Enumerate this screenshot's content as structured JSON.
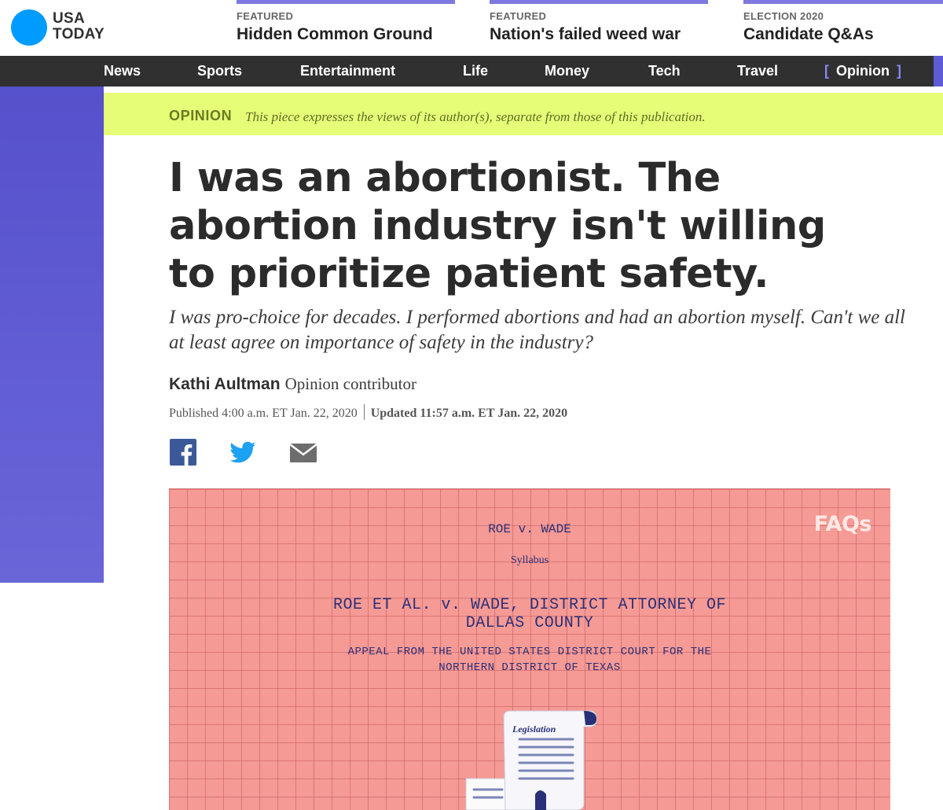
{
  "brand": {
    "line1": "USA",
    "line2": "TODAY"
  },
  "promos": [
    {
      "kicker": "FEATURED",
      "headline": "Hidden Common Ground"
    },
    {
      "kicker": "FEATURED",
      "headline": "Nation's failed weed war"
    },
    {
      "kicker": "ELECTION 2020",
      "headline": "Candidate Q&As"
    }
  ],
  "nav": {
    "items": [
      "News",
      "Sports",
      "Entertainment",
      "Life",
      "Money",
      "Tech",
      "Travel"
    ],
    "active": {
      "open": "[",
      "label": "Opinion",
      "close": "]"
    }
  },
  "banner": {
    "label": "OPINION",
    "note": "This piece expresses the views of its author(s), separate from those of this publication."
  },
  "article": {
    "title": "I was an abortionist. The abortion industry isn't willing to prioritize patient safety.",
    "dek": "I was pro-choice for decades. I performed abortions and had an abortion myself. Can't we all at least agree on importance of safety in the industry?",
    "author": "Kathi Aultman",
    "role": "Opinion contributor",
    "published": "Published 4:00 a.m. ET Jan. 22, 2020",
    "updated": "Updated 11:57 a.m. ET Jan. 22, 2020"
  },
  "share": {
    "icons": [
      "facebook-icon",
      "twitter-icon",
      "email-icon"
    ]
  },
  "media": {
    "badge": "FAQs",
    "doc_line1": "ROE v. WADE",
    "doc_line2": "Syllabus",
    "doc_line3": "ROE ET AL. v. WADE, DISTRICT ATTORNEY OF",
    "doc_line4": "DALLAS COUNTY",
    "doc_line5": "APPEAL FROM THE UNITED STATES DISTRICT COURT FOR THE",
    "doc_line6": "NORTHERN DISTRICT OF TEXAS",
    "scroll_label": "Legislation"
  },
  "colors": {
    "brand_blue": "#009bff",
    "nav_bg": "#303030",
    "accent_purple": "#5e5bd4",
    "banner_bg": "#e6fd78",
    "media_bg": "#f59a95",
    "facebook": "#3b5998",
    "twitter": "#1da1f2"
  }
}
